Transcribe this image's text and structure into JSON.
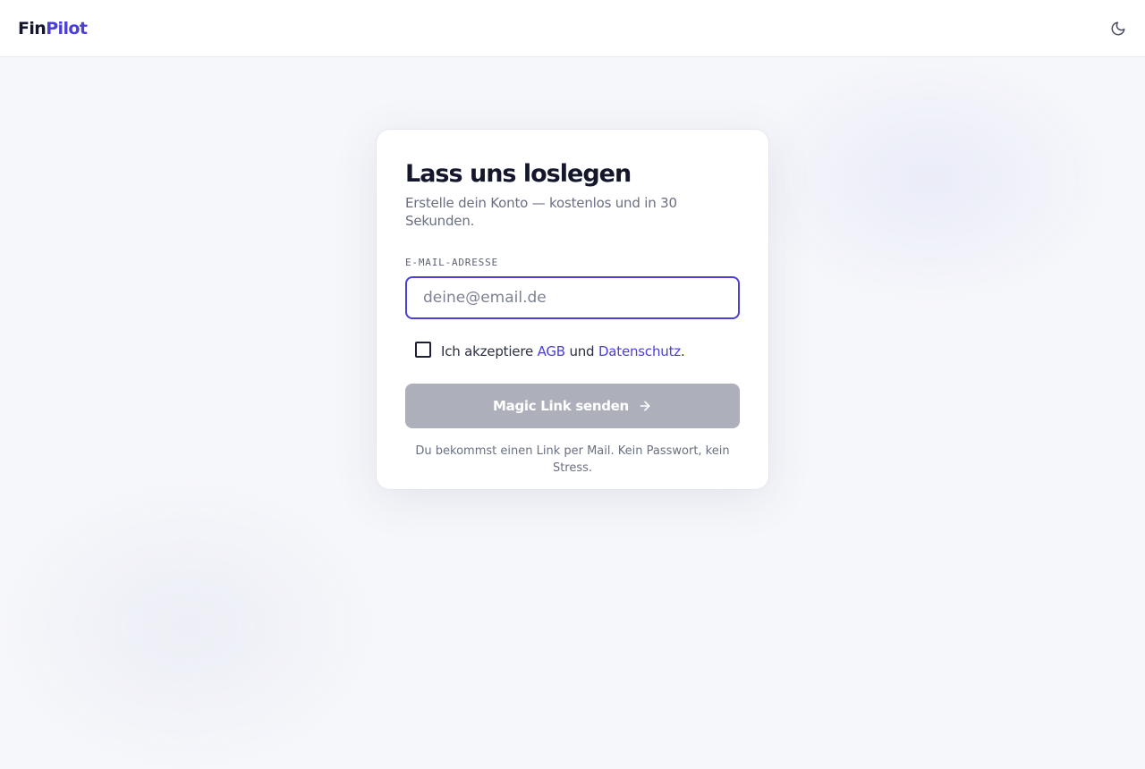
{
  "brand": {
    "part1": "Fin",
    "part2": "Pilot",
    "accent_color": "#4b3fd6"
  },
  "header": {
    "theme_toggle_icon": "moon-icon"
  },
  "card": {
    "title": "Lass uns loslegen",
    "subtitle": "Erstelle dein Konto — kostenlos und in 30 Sekunden.",
    "email": {
      "label": "E-MAIL-ADRESSE",
      "placeholder": "deine@email.de",
      "value": ""
    },
    "consent": {
      "checked": false,
      "prefix": "Ich akzeptiere ",
      "terms_link": "AGB",
      "middle": " und ",
      "privacy_link": "Datenschutz",
      "suffix": "."
    },
    "submit": {
      "label": "Magic Link senden",
      "icon": "arrow-right-icon",
      "disabled": true
    },
    "hint": "Du bekommst einen Link per Mail. Kein Passwort, kein Stress."
  }
}
